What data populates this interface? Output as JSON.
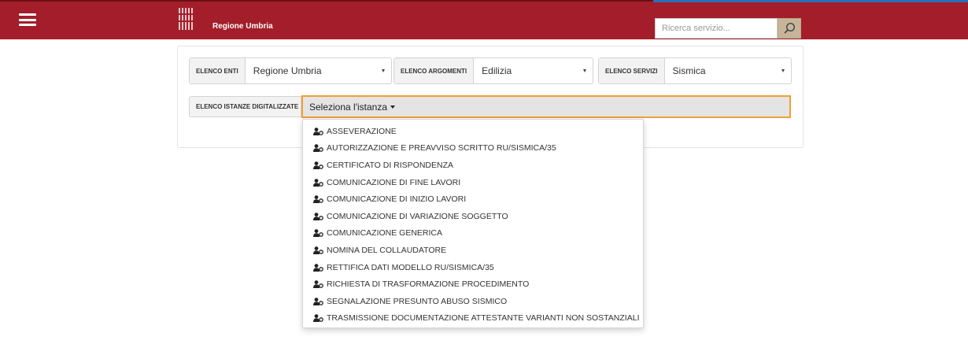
{
  "header": {
    "brand": "Regione Umbria",
    "search_placeholder": "Ricerca servizio...",
    "colors": {
      "bar": "#a31e2a",
      "accent_line": "#2b6fb6",
      "search_button": "#c7b59a"
    }
  },
  "filters": {
    "enti": {
      "label": "ELENCO ENTI",
      "value": "Regione Umbria"
    },
    "argomenti": {
      "label": "ELENCO ARGOMENTI",
      "value": "Edilizia"
    },
    "servizi": {
      "label": "ELENCO SERVIZI",
      "value": "Sismica"
    },
    "istanze": {
      "label": "ELENCO ISTANZE DIGITALIZZATE",
      "button": "Seleziona l'istanza",
      "focus_color": "#f0a030"
    }
  },
  "menu": {
    "icon": "user-key-icon",
    "items": [
      "ASSEVERAZIONE",
      "AUTORIZZAZIONE E PREAVVISO SCRITTO RU/SISMICA/35",
      "CERTIFICATO DI RISPONDENZA",
      "COMUNICAZIONE DI FINE LAVORI",
      "COMUNICAZIONE DI INIZIO LAVORI",
      "COMUNICAZIONE DI VARIAZIONE SOGGETTO",
      "COMUNICAZIONE GENERICA",
      "NOMINA DEL COLLAUDATORE",
      "RETTIFICA DATI MODELLO RU/SISMICA/35",
      "RICHIESTA DI TRASFORMAZIONE PROCEDIMENTO",
      "SEGNALAZIONE PRESUNTO ABUSO SISMICO",
      "TRASMISSIONE DOCUMENTAZIONE ATTESTANTE VARIANTI NON SOSTANZIALI"
    ]
  }
}
